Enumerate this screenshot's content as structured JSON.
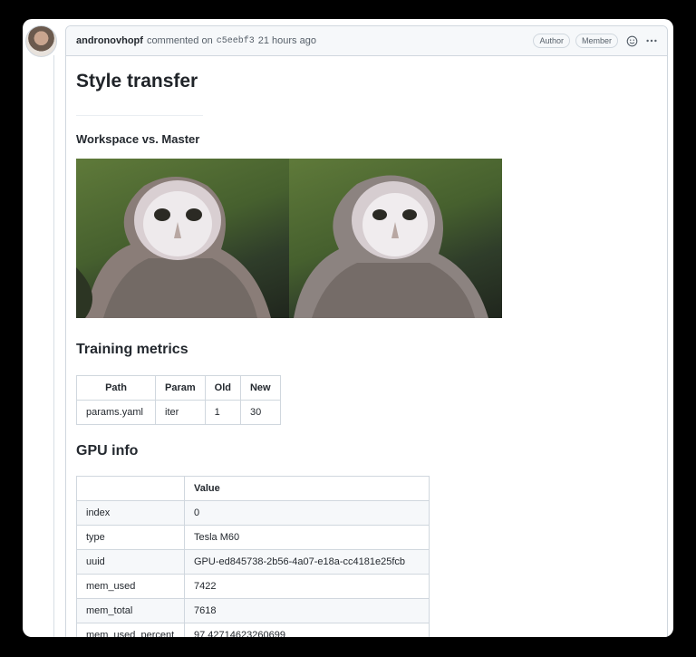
{
  "comment": {
    "author": "andronovhopf",
    "action": "commented on",
    "sha": "c5eebf3",
    "time": "21 hours ago",
    "badges": [
      "Author",
      "Member"
    ]
  },
  "report": {
    "title": "Style transfer",
    "images_heading": "Workspace vs. Master",
    "metrics_heading": "Training metrics",
    "metrics_table": {
      "headers": [
        "Path",
        "Param",
        "Old",
        "New"
      ],
      "rows": [
        [
          "params.yaml",
          "iter",
          "1",
          "30"
        ]
      ]
    },
    "gpu_heading": "GPU info",
    "gpu_table": {
      "headers": [
        "",
        "Value"
      ],
      "rows": [
        [
          "index",
          "0"
        ],
        [
          "type",
          "Tesla M60"
        ],
        [
          "uuid",
          "GPU-ed845738-2b56-4a07-e18a-cc4181e25fcb"
        ],
        [
          "mem_used",
          "7422"
        ],
        [
          "mem_total",
          "7618"
        ],
        [
          "mem_used_percent",
          "97.42714623260699"
        ]
      ]
    }
  },
  "colors": {
    "background": "#000000",
    "border": "#d0d7de",
    "header_bg": "#f6f8fa",
    "text": "#24292f"
  },
  "icons": [
    "smiley-icon",
    "kebab-menu-icon"
  ]
}
